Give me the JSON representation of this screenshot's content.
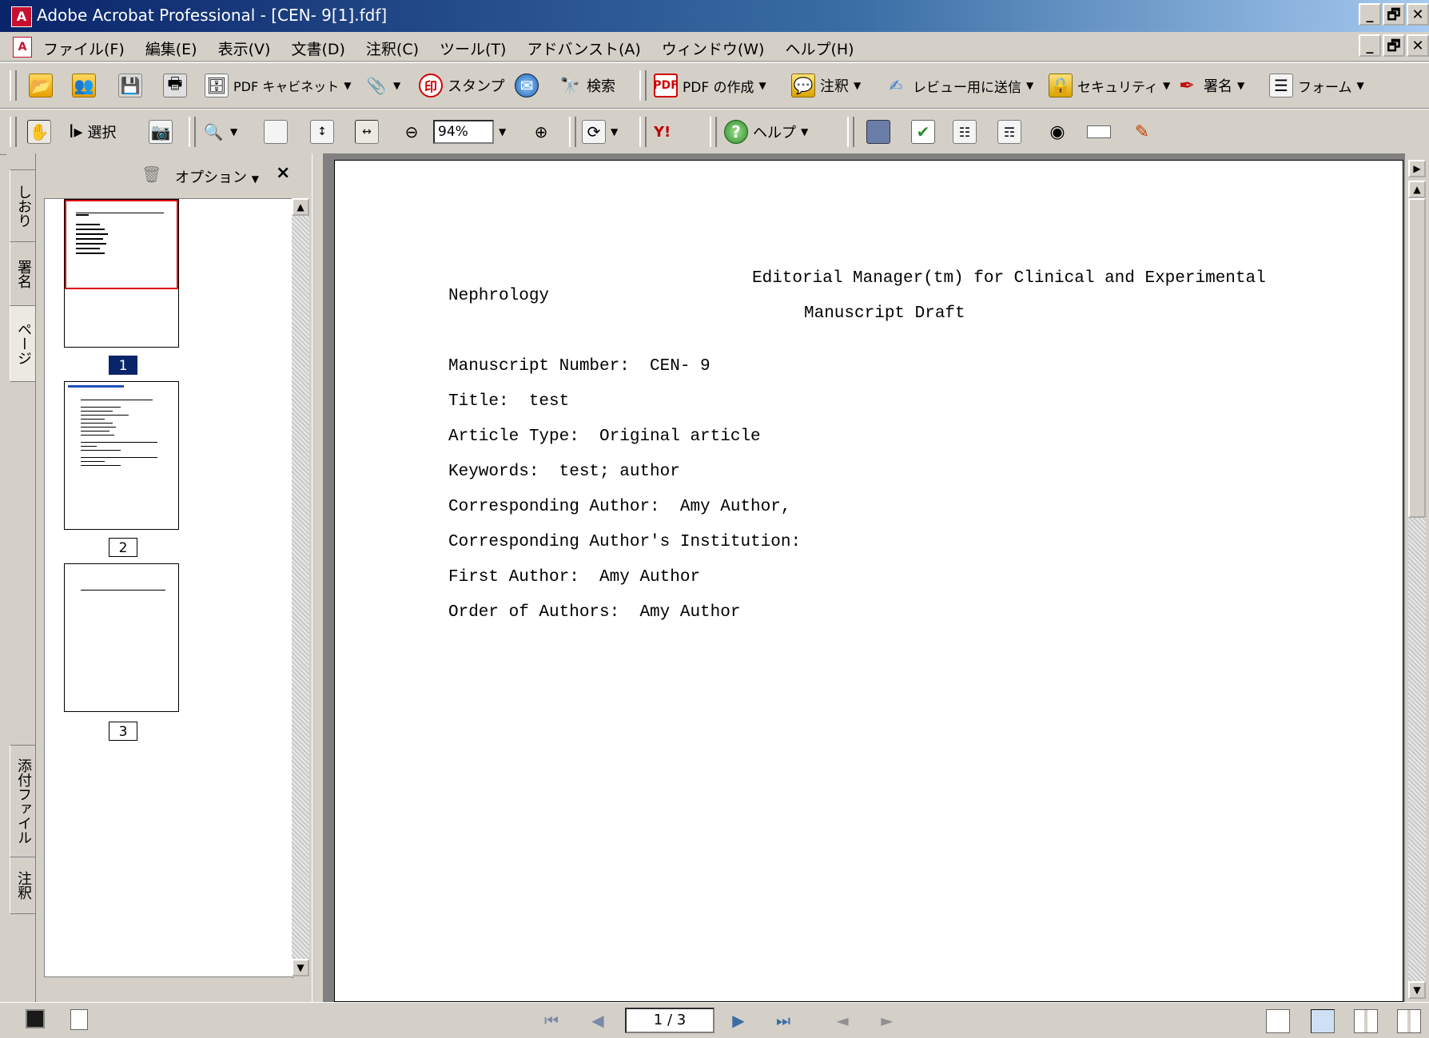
{
  "window": {
    "title": "Adobe Acrobat Professional - [CEN- 9[1].fdf]",
    "app_icon": "acrobat-icon",
    "buttons": [
      "_",
      "🗗",
      "✕"
    ],
    "doc_buttons": [
      "_",
      "🗗",
      "✕"
    ]
  },
  "menu": [
    "ファイル(F)",
    "編集(E)",
    "表示(V)",
    "文書(D)",
    "注釈(C)",
    "ツール(T)",
    "アドバンスト(A)",
    "ウィンドウ(W)",
    "ヘルプ(H)"
  ],
  "toolbar1": {
    "pdf_cabinet": "PDF キャビネット",
    "stamp": "スタンプ",
    "search": "検索",
    "create_pdf": "PDF の作成",
    "comment": "注釈",
    "send_review": "レビュー用に送信",
    "security": "セキュリティ",
    "sign": "署名",
    "forms": "フォーム"
  },
  "toolbar2": {
    "select": "選択",
    "zoom_value": "94%",
    "help": "ヘルプ",
    "yahoo": "Y!"
  },
  "nav_tabs": {
    "bookmarks": "しおり",
    "signatures": "署名",
    "pages": "ページ",
    "attachments": "添付ファイル",
    "comments": "注釈"
  },
  "panel": {
    "options": "オプション",
    "close": "×",
    "pages": [
      {
        "num": "1"
      },
      {
        "num": "2"
      },
      {
        "num": "3"
      }
    ]
  },
  "document": {
    "header_line1": "Editorial Manager(tm) for Clinical and Experimental",
    "header_line2": "Nephrology",
    "header_line3": "Manuscript Draft",
    "fields": [
      "Manuscript Number:  CEN- 9",
      "Title:  test",
      "Article Type:  Original article",
      "Keywords:  test; author",
      "Corresponding Author:  Amy Author,",
      "Corresponding Author's Institution:",
      "First Author:  Amy Author",
      "Order of Authors:  Amy Author"
    ]
  },
  "status": {
    "page_indicator": "1 / 3"
  }
}
